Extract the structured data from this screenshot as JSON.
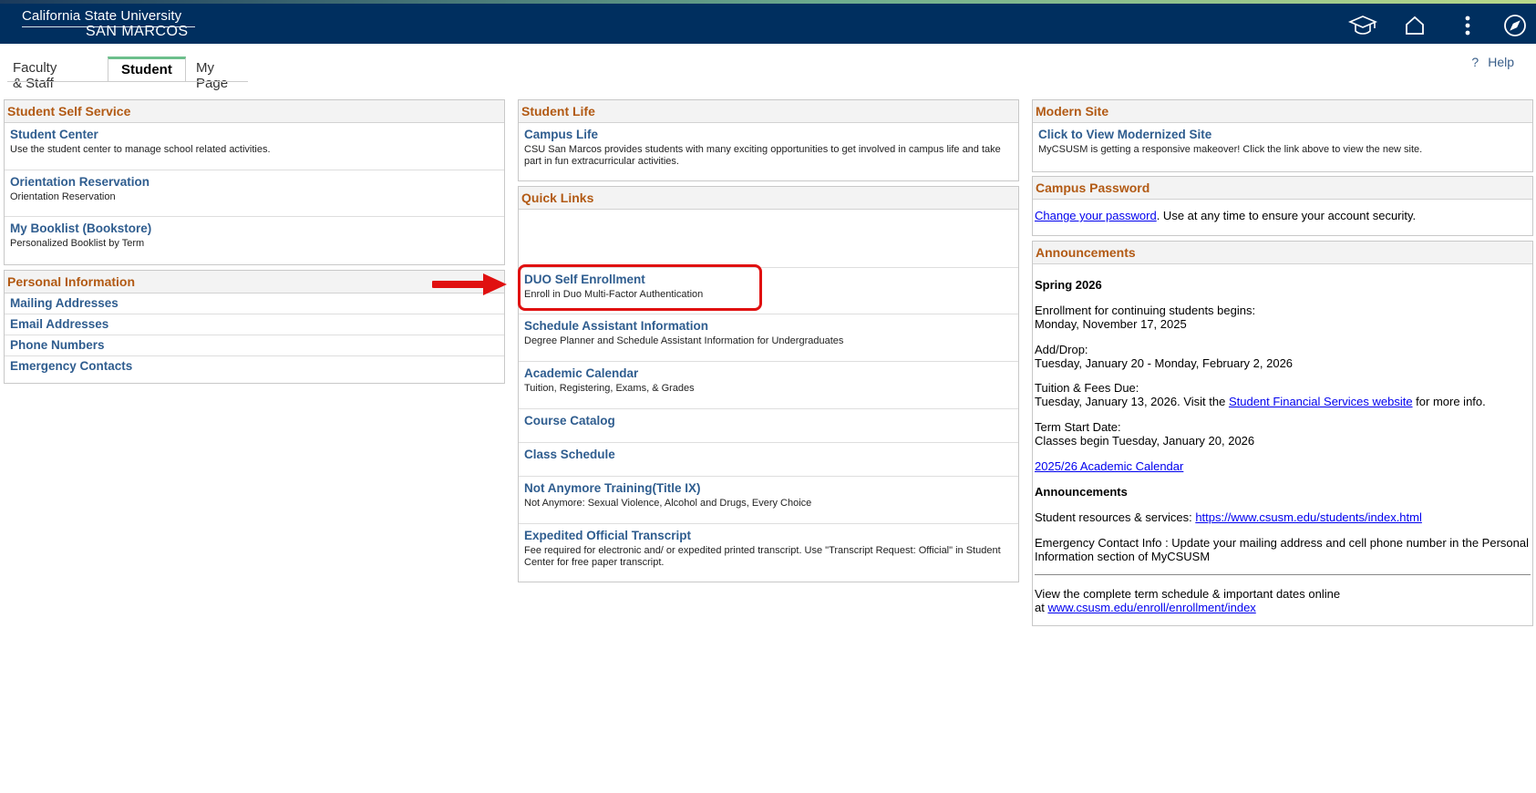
{
  "logo": {
    "line1": "California State University",
    "line2": "SAN MARCOS"
  },
  "header_icons": [
    "graduation-cap-icon",
    "home-icon",
    "more-vertical-icon",
    "compass-icon"
  ],
  "tabs": [
    {
      "label": "Faculty & Staff",
      "active": false
    },
    {
      "label": "Student",
      "active": true
    },
    {
      "label": "My Page",
      "active": false
    }
  ],
  "help": {
    "icon": "?",
    "label": "Help"
  },
  "student_self_service": {
    "title": "Student Self Service",
    "items": [
      {
        "label": "Student Center",
        "desc": "Use the student center to manage school related activities."
      },
      {
        "label": "Orientation Reservation",
        "desc": "Orientation Reservation"
      },
      {
        "label": "My Booklist (Bookstore)",
        "desc": "Personalized Booklist by Term"
      }
    ]
  },
  "personal_information": {
    "title": "Personal Information",
    "items": [
      "Mailing Addresses",
      "Email Addresses",
      "Phone Numbers",
      "Emergency Contacts"
    ]
  },
  "student_life": {
    "title": "Student Life",
    "items": [
      {
        "label": "Campus Life",
        "desc": "CSU San Marcos provides students with many exciting opportunities to get involved in campus life and take part in fun extracurricular activities."
      }
    ]
  },
  "quick_links": {
    "title": "Quick Links",
    "items": [
      {
        "label": "DUO Self Enrollment",
        "desc": "Enroll in Duo Multi-Factor Authentication"
      },
      {
        "label": "Schedule Assistant Information",
        "desc": "Degree Planner and Schedule Assistant Information for Undergraduates"
      },
      {
        "label": "Academic Calendar",
        "desc": "Tuition, Registering, Exams, & Grades"
      },
      {
        "label": "Course Catalog",
        "desc": ""
      },
      {
        "label": "Class Schedule",
        "desc": ""
      },
      {
        "label": "Not Anymore Training(Title IX)",
        "desc": "Not Anymore: Sexual Violence, Alcohol and Drugs, Every Choice"
      },
      {
        "label": "Expedited Official Transcript",
        "desc": "Fee required for electronic and/ or expedited printed transcript. Use \"Transcript Request: Official\" in Student Center for free paper transcript."
      }
    ]
  },
  "modern_site": {
    "title": "Modern Site",
    "link": "Click to View Modernized Site",
    "desc": "MyCSUSM is getting a responsive makeover! Click the link above to view the new site."
  },
  "campus_password": {
    "title": "Campus Password",
    "link": "Change your password",
    "text": ".  Use at any time to ensure your account security."
  },
  "announcements": {
    "title": "Announcements",
    "term": "Spring 2026",
    "enroll_label": "Enrollment for continuing students begins:",
    "enroll_date": "Monday, November 17, 2025",
    "adddrop_label": "Add/Drop:",
    "adddrop_date": "Tuesday, January 20 - Monday, February 2, 2026",
    "tuition_label": "Tuition & Fees Due:",
    "tuition_prefix": "Tuesday, January 13, 2026. Visit the ",
    "tuition_link": "Student Financial Services website",
    "tuition_suffix": " for more info.",
    "term_start_label": "Term Start Date:",
    "term_start_text": "Classes begin Tuesday, January 20, 2026",
    "calendar_link": "2025/26 Academic Calendar",
    "subheading": "Announcements",
    "resources_prefix": "Student resources & services: ",
    "resources_link": "https://www.csusm.edu/students/index.html",
    "emergency_text": "Emergency Contact Info : Update your mailing address and cell phone number in the Personal Information section of MyCSUSM",
    "schedule_text": "View the complete term schedule & important dates online",
    "schedule_prefix": "at ",
    "schedule_link": "www.csusm.edu/enroll/enrollment/index"
  },
  "annotation_color": "#e01010"
}
